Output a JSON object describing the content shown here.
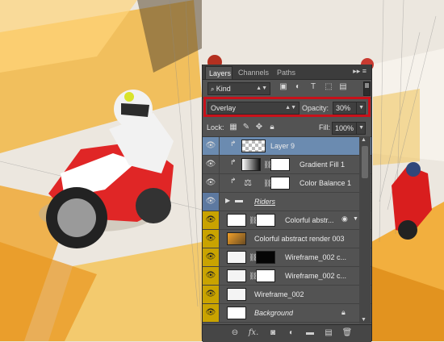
{
  "colors": {
    "panel_bg": "#535353",
    "selected_row": "#6b8bb0",
    "highlight_box": "#c8111a",
    "eye_yellow": "#c9a300"
  },
  "tabs": [
    {
      "label": "Layers",
      "active": true
    },
    {
      "label": "Channels",
      "active": false
    },
    {
      "label": "Paths",
      "active": false
    }
  ],
  "panel_menu_icon": "double-chevron-menu-icon",
  "filter": {
    "kind_label": "Kind",
    "icons": [
      "pixel-filter-icon",
      "adjustment-filter-icon",
      "type-filter-icon",
      "shape-filter-icon",
      "smart-object-filter-icon"
    ]
  },
  "blend": {
    "mode": "Overlay",
    "opacity_label": "Opacity:",
    "opacity_value": "30%"
  },
  "lock": {
    "label": "Lock:",
    "fill_label": "Fill:",
    "fill_value": "100%"
  },
  "layers": [
    {
      "name": "Layer 9",
      "selected": true,
      "eye_highlight": false
    },
    {
      "name": "Gradient Fill 1",
      "selected": false,
      "eye_highlight": false
    },
    {
      "name": "Color Balance 1",
      "selected": false,
      "eye_highlight": false
    },
    {
      "name": "Riders",
      "selected": false,
      "eye_highlight": false,
      "is_group": true
    },
    {
      "name": "Colorful abstr...",
      "selected": false,
      "eye_highlight": true
    },
    {
      "name": "Colorful abstract render 003",
      "selected": false,
      "eye_highlight": true
    },
    {
      "name": "Wireframe_002 c...",
      "selected": false,
      "eye_highlight": true
    },
    {
      "name": "Wireframe_002 c...",
      "selected": false,
      "eye_highlight": true
    },
    {
      "name": "Wireframe_002",
      "selected": false,
      "eye_highlight": true
    },
    {
      "name": "Background",
      "selected": false,
      "eye_highlight": true,
      "locked": true
    }
  ],
  "bottom_icons": [
    "link-layers-icon",
    "fx-icon",
    "add-mask-icon",
    "new-adjustment-icon",
    "new-group-icon",
    "new-layer-icon",
    "trash-icon"
  ],
  "fx_text": "fx."
}
